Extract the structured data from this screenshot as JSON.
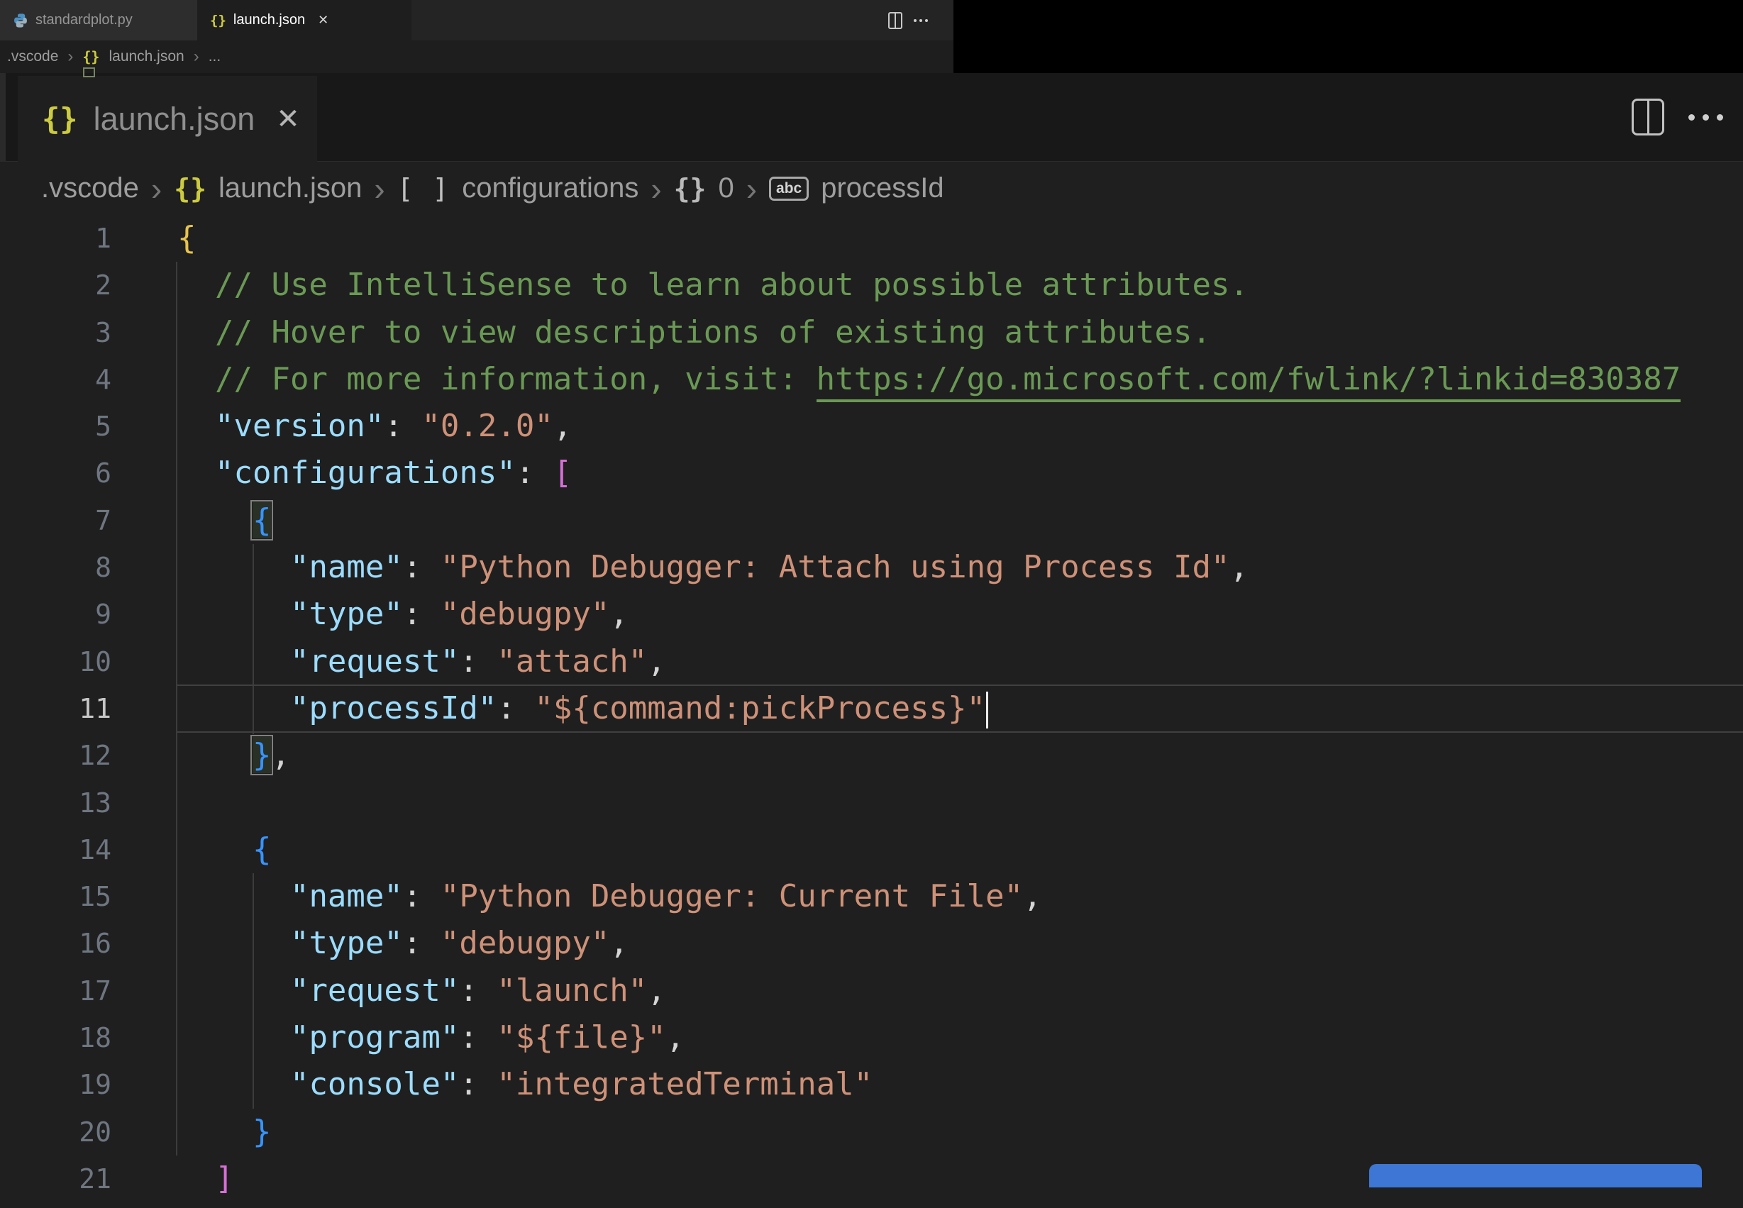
{
  "icons": {
    "braces": "{}",
    "close": "✕",
    "chevron": "›",
    "abc_label": "abc",
    "array_brackets": "[ ]"
  },
  "mini": {
    "tabs": [
      {
        "label": "standardplot.py"
      },
      {
        "label": "launch.json"
      }
    ],
    "breadcrumb": {
      "folder": ".vscode",
      "file": "launch.json",
      "more": "..."
    }
  },
  "editor": {
    "tab": {
      "label": "launch.json"
    },
    "breadcrumb": {
      "folder": ".vscode",
      "file": "launch.json",
      "configurations": "configurations",
      "index": "0",
      "property": "processId"
    },
    "active_line": 11,
    "lines": [
      {
        "n": 1,
        "tokens": [
          [
            "b1",
            "{"
          ]
        ]
      },
      {
        "n": 2,
        "tokens": [
          [
            "com",
            "  // Use IntelliSense to learn about possible attributes."
          ]
        ]
      },
      {
        "n": 3,
        "tokens": [
          [
            "com",
            "  // Hover to view descriptions of existing attributes."
          ]
        ]
      },
      {
        "n": 4,
        "tokens": [
          [
            "com",
            "  // For more information, visit: "
          ],
          [
            "link",
            "https://go.microsoft.com/fwlink/?linkid=830387"
          ]
        ]
      },
      {
        "n": 5,
        "tokens": [
          [
            "pln",
            "  "
          ],
          [
            "key",
            "\"version\""
          ],
          [
            "pun",
            ": "
          ],
          [
            "str",
            "\"0.2.0\""
          ],
          [
            "pun",
            ","
          ]
        ]
      },
      {
        "n": 6,
        "tokens": [
          [
            "pln",
            "  "
          ],
          [
            "key",
            "\"configurations\""
          ],
          [
            "pun",
            ": "
          ],
          [
            "b2",
            "["
          ]
        ]
      },
      {
        "n": 7,
        "tokens": [
          [
            "pln",
            "    "
          ],
          [
            "b3m",
            "{"
          ]
        ]
      },
      {
        "n": 8,
        "tokens": [
          [
            "pln",
            "      "
          ],
          [
            "key",
            "\"name\""
          ],
          [
            "pun",
            ": "
          ],
          [
            "str",
            "\"Python Debugger: Attach using Process Id\""
          ],
          [
            "pun",
            ","
          ]
        ]
      },
      {
        "n": 9,
        "tokens": [
          [
            "pln",
            "      "
          ],
          [
            "key",
            "\"type\""
          ],
          [
            "pun",
            ": "
          ],
          [
            "str",
            "\"debugpy\""
          ],
          [
            "pun",
            ","
          ]
        ]
      },
      {
        "n": 10,
        "tokens": [
          [
            "pln",
            "      "
          ],
          [
            "key",
            "\"request\""
          ],
          [
            "pun",
            ": "
          ],
          [
            "str",
            "\"attach\""
          ],
          [
            "pun",
            ","
          ]
        ]
      },
      {
        "n": 11,
        "current": true,
        "cursor": true,
        "tokens": [
          [
            "pln",
            "      "
          ],
          [
            "key",
            "\"processId\""
          ],
          [
            "pun",
            ": "
          ],
          [
            "str",
            "\"${command:pickProcess}\""
          ]
        ]
      },
      {
        "n": 12,
        "tokens": [
          [
            "pln",
            "    "
          ],
          [
            "b3m",
            "}"
          ],
          [
            "pun",
            ","
          ]
        ]
      },
      {
        "n": 13,
        "tokens": []
      },
      {
        "n": 14,
        "tokens": [
          [
            "pln",
            "    "
          ],
          [
            "b3",
            "{"
          ]
        ]
      },
      {
        "n": 15,
        "tokens": [
          [
            "pln",
            "      "
          ],
          [
            "key",
            "\"name\""
          ],
          [
            "pun",
            ": "
          ],
          [
            "str",
            "\"Python Debugger: Current File\""
          ],
          [
            "pun",
            ","
          ]
        ]
      },
      {
        "n": 16,
        "tokens": [
          [
            "pln",
            "      "
          ],
          [
            "key",
            "\"type\""
          ],
          [
            "pun",
            ": "
          ],
          [
            "str",
            "\"debugpy\""
          ],
          [
            "pun",
            ","
          ]
        ]
      },
      {
        "n": 17,
        "tokens": [
          [
            "pln",
            "      "
          ],
          [
            "key",
            "\"request\""
          ],
          [
            "pun",
            ": "
          ],
          [
            "str",
            "\"launch\""
          ],
          [
            "pun",
            ","
          ]
        ]
      },
      {
        "n": 18,
        "tokens": [
          [
            "pln",
            "      "
          ],
          [
            "key",
            "\"program\""
          ],
          [
            "pun",
            ": "
          ],
          [
            "str",
            "\"${file}\""
          ],
          [
            "pun",
            ","
          ]
        ]
      },
      {
        "n": 19,
        "tokens": [
          [
            "pln",
            "      "
          ],
          [
            "key",
            "\"console\""
          ],
          [
            "pun",
            ": "
          ],
          [
            "str",
            "\"integratedTerminal\""
          ]
        ]
      },
      {
        "n": 20,
        "tokens": [
          [
            "pln",
            "    "
          ],
          [
            "b3",
            "}"
          ]
        ]
      },
      {
        "n": 21,
        "tokens": [
          [
            "pln",
            "  "
          ],
          [
            "b2",
            "]"
          ]
        ]
      }
    ]
  },
  "colors": {
    "editor_bg": "#1f1f1f",
    "tabstrip_bg": "#181818",
    "black_region": "#000000",
    "button_blue": "#3d76d4",
    "key": "#9cdcfe",
    "string": "#ce9178",
    "comment": "#6a9955",
    "bracket_gold": "#e6c34c",
    "bracket_pink": "#d670d6",
    "bracket_blue": "#3794ff",
    "json_icon_yellow": "#cbcb41"
  }
}
